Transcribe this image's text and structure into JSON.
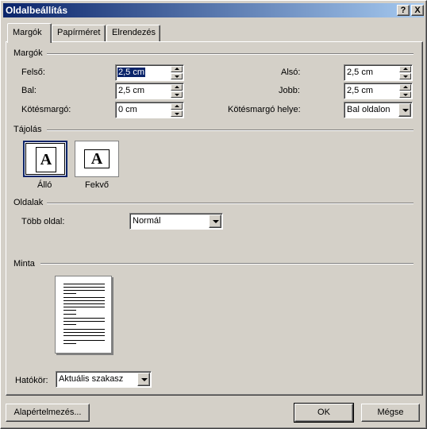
{
  "window": {
    "title": "Oldalbeállítás",
    "help_button": "?",
    "close_button": "X",
    "titlebar_color": "#0a246a"
  },
  "tabs": [
    {
      "label": "Margók",
      "active": true
    },
    {
      "label": "Papírméret",
      "active": false
    },
    {
      "label": "Elrendezés",
      "active": false
    }
  ],
  "margins": {
    "group_title": "Margók",
    "top": {
      "label": "Felső:",
      "value": "2,5 cm"
    },
    "bottom": {
      "label": "Alsó:",
      "value": "2,5 cm"
    },
    "left": {
      "label": "Bal:",
      "value": "2,5 cm"
    },
    "right": {
      "label": "Jobb:",
      "value": "2,5 cm"
    },
    "gutter": {
      "label": "Kötésmargó:",
      "value": "0 cm"
    },
    "gutter_position": {
      "label": "Kötésmargó helye:",
      "value": "Bal oldalon"
    }
  },
  "orientation": {
    "group_title": "Tájolás",
    "portrait": {
      "label": "Álló",
      "glyph": "A",
      "selected": true
    },
    "landscape": {
      "label": "Fekvő",
      "glyph": "A",
      "selected": false
    }
  },
  "pages": {
    "group_title": "Oldalak",
    "multiple_pages": {
      "label": "Több oldal:",
      "value": "Normál"
    }
  },
  "preview": {
    "group_title": "Minta"
  },
  "apply_to": {
    "label": "Hatókör:",
    "value": "Aktuális szakasz"
  },
  "buttons": {
    "default": "Alapértelmezés...",
    "ok": "OK",
    "cancel": "Mégse"
  }
}
